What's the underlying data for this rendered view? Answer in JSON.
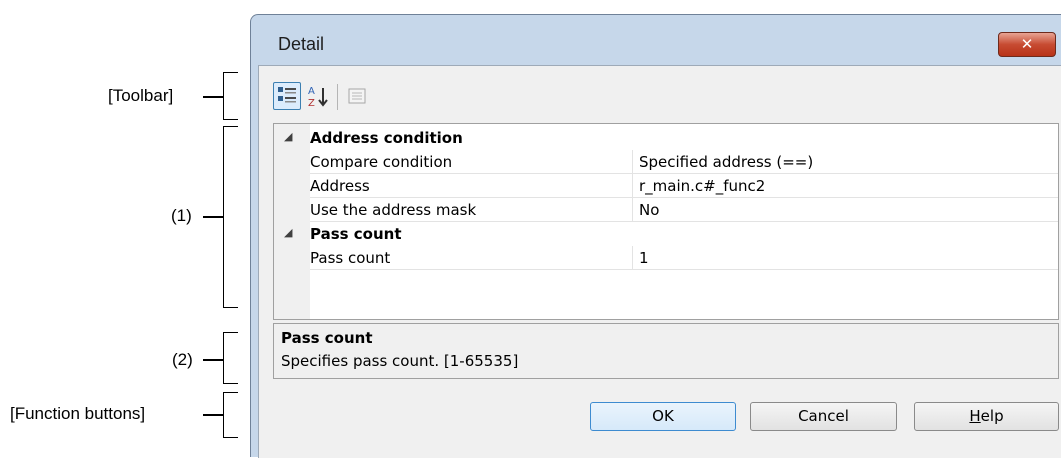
{
  "annotations": {
    "toolbar": "[Toolbar]",
    "area1": "(1)",
    "area2": "(2)",
    "function_buttons": "[Function buttons]"
  },
  "dialog": {
    "title": "Detail",
    "close_glyph": "✕",
    "toolbar": {
      "categorized_icon": "categorized-view-icon",
      "alphabetical_icon": "sort-alphabetical-icon",
      "property_pages_icon": "property-pages-icon"
    },
    "grid": {
      "categories": [
        {
          "label": "Address condition",
          "properties": [
            {
              "name": "Compare condition",
              "value": "Specified address (==)"
            },
            {
              "name": "Address",
              "value": "r_main.c#_func2"
            },
            {
              "name": "Use the address mask",
              "value": "No"
            }
          ]
        },
        {
          "label": "Pass count",
          "properties": [
            {
              "name": "Pass count",
              "value": "1"
            }
          ]
        }
      ]
    },
    "description": {
      "title": "Pass count",
      "text": "Specifies pass count. [1-65535]"
    },
    "buttons": {
      "ok": "OK",
      "cancel": "Cancel",
      "help": "Help"
    }
  }
}
